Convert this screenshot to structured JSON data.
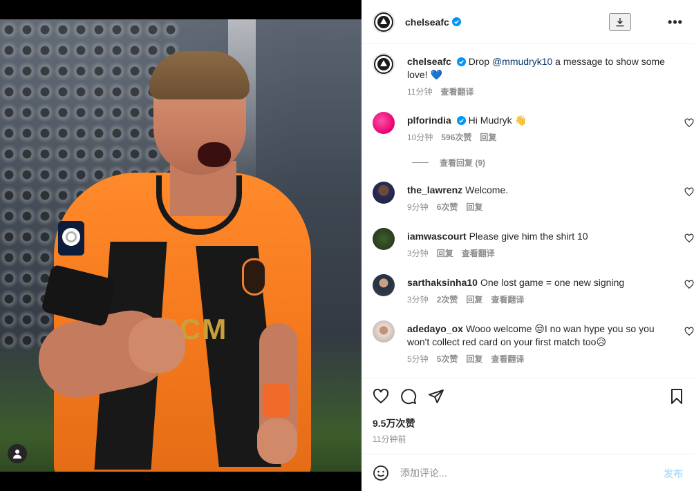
{
  "colors": {
    "accent": "#0095f6",
    "verified": "#0095f6",
    "text": "#262626",
    "muted": "#8e8e8e",
    "mention": "#00376b"
  },
  "media": {
    "sponsor_text": "SCM",
    "user_tag_icon": "person-icon"
  },
  "header": {
    "username": "chelseafc",
    "verified_icon": "verified-badge-icon",
    "download_icon": "download-icon",
    "more_icon": "more-options-icon",
    "more_label": "•••"
  },
  "caption": {
    "username": "chelseafc",
    "text_before": "Drop ",
    "mention": "@mmudryk10",
    "text_after": " a message to show some love! ",
    "emoji": "💙",
    "time": "11分钟",
    "translate": "查看翻译"
  },
  "comments": [
    {
      "username": "plforindia",
      "verified": true,
      "text": "Hi Mudryk ",
      "emoji": "👋",
      "time": "10分钟",
      "likes": "596次赞",
      "reply": "回复",
      "view_replies": "查看回复 (9)"
    },
    {
      "username": "the_lawrenz",
      "verified": false,
      "text": "Welcome.",
      "time": "9分钟",
      "likes": "6次赞",
      "reply": "回复"
    },
    {
      "username": "iamwascourt",
      "verified": false,
      "text": "Please give him the shirt 10",
      "time": "3分钟",
      "reply": "回复",
      "translate": "查看翻译"
    },
    {
      "username": "sarthaksinha10",
      "verified": false,
      "text": "One lost game = one new signing",
      "time": "3分钟",
      "likes": "2次赞",
      "reply": "回复",
      "translate": "查看翻译"
    },
    {
      "username": "adedayo_ox",
      "verified": false,
      "text_part1": "Wooo welcome ",
      "emoji1": "😒",
      "text_part2": "I no wan hype you so you won't collect red card on your first match too",
      "emoji2": "😥",
      "time": "5分钟",
      "likes": "5次赞",
      "reply": "回复",
      "translate": "查看翻译"
    }
  ],
  "actions": {
    "like_icon": "heart-icon",
    "comment_icon": "comment-icon",
    "share_icon": "share-icon",
    "save_icon": "bookmark-icon"
  },
  "likes": "9.5万次赞",
  "time_ago": "11分钟前",
  "add_comment": {
    "placeholder": "添加评论...",
    "post_label": "发布",
    "emoji_icon": "emoji-icon"
  }
}
